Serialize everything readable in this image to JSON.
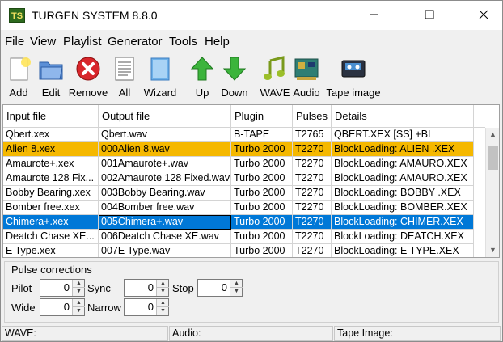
{
  "window": {
    "title": "TURGEN SYSTEM 8.8.0",
    "icon_text": "TS"
  },
  "menu": [
    "File",
    "View",
    "Playlist",
    "Generator",
    "Tools",
    "Help"
  ],
  "toolbar": [
    {
      "label": "Add",
      "icon": "add-icon"
    },
    {
      "label": "Edit",
      "icon": "edit-icon"
    },
    {
      "label": "Remove",
      "icon": "remove-icon"
    },
    {
      "label": "All",
      "icon": "all-icon"
    },
    {
      "label": "Wizard",
      "icon": "wizard-icon"
    },
    {
      "label": "Up",
      "icon": "arrow-up-icon"
    },
    {
      "label": "Down",
      "icon": "arrow-down-icon"
    },
    {
      "label": "WAVE",
      "icon": "music-note-icon"
    },
    {
      "label": "Audio",
      "icon": "audio-card-icon"
    },
    {
      "label": "Tape image",
      "icon": "cassette-icon"
    }
  ],
  "grid": {
    "columns": [
      "Input file",
      "Output file",
      "Plugin",
      "Pulses",
      "Details"
    ],
    "rows": [
      [
        "Qbert.xex",
        "Qbert.wav",
        "B-TAPE",
        "T2765",
        "QBERT.XEX [SS] +BL"
      ],
      [
        "Alien 8.xex",
        "000Alien 8.wav",
        "Turbo 2000",
        "T2270",
        "BlockLoading: ALIEN .XEX"
      ],
      [
        "Amaurote+.xex",
        "001Amaurote+.wav",
        "Turbo 2000",
        "T2270",
        "BlockLoading: AMAURO.XEX"
      ],
      [
        "Amaurote 128 Fix...",
        "002Amaurote 128 Fixed.wav",
        "Turbo 2000",
        "T2270",
        "BlockLoading: AMAURO.XEX"
      ],
      [
        "Bobby Bearing.xex",
        "003Bobby Bearing.wav",
        "Turbo 2000",
        "T2270",
        "BlockLoading: BOBBY .XEX"
      ],
      [
        "Bomber free.xex",
        "004Bomber free.wav",
        "Turbo 2000",
        "T2270",
        "BlockLoading: BOMBER.XEX"
      ],
      [
        "Chimera+.xex",
        "005Chimera+.wav",
        "Turbo 2000",
        "T2270",
        "BlockLoading: CHIMER.XEX"
      ],
      [
        "Deatch Chase XE...",
        "006Deatch Chase XE.wav",
        "Turbo 2000",
        "T2270",
        "BlockLoading: DEATCH.XEX"
      ],
      [
        "E Type.xex",
        "007E Type.wav",
        "Turbo 2000",
        "T2270",
        "BlockLoading: E TYPE.XEX"
      ],
      [
        "",
        "",
        "",
        "",
        ""
      ]
    ],
    "highlight_rows": {
      "orange": 1,
      "selected": 6
    }
  },
  "pulse_corrections": {
    "title": "Pulse corrections",
    "pilot": {
      "label": "Pilot",
      "value": "0"
    },
    "sync": {
      "label": "Sync",
      "value": "0"
    },
    "stop": {
      "label": "Stop",
      "value": "0"
    },
    "wide": {
      "label": "Wide",
      "value": "0"
    },
    "narrow": {
      "label": "Narrow",
      "value": "0"
    }
  },
  "status": {
    "wave": "WAVE:",
    "audio": "Audio:",
    "tape": "Tape Image:"
  },
  "colors": {
    "orange_row": "#f5b800",
    "selected_row": "#0078d7"
  }
}
